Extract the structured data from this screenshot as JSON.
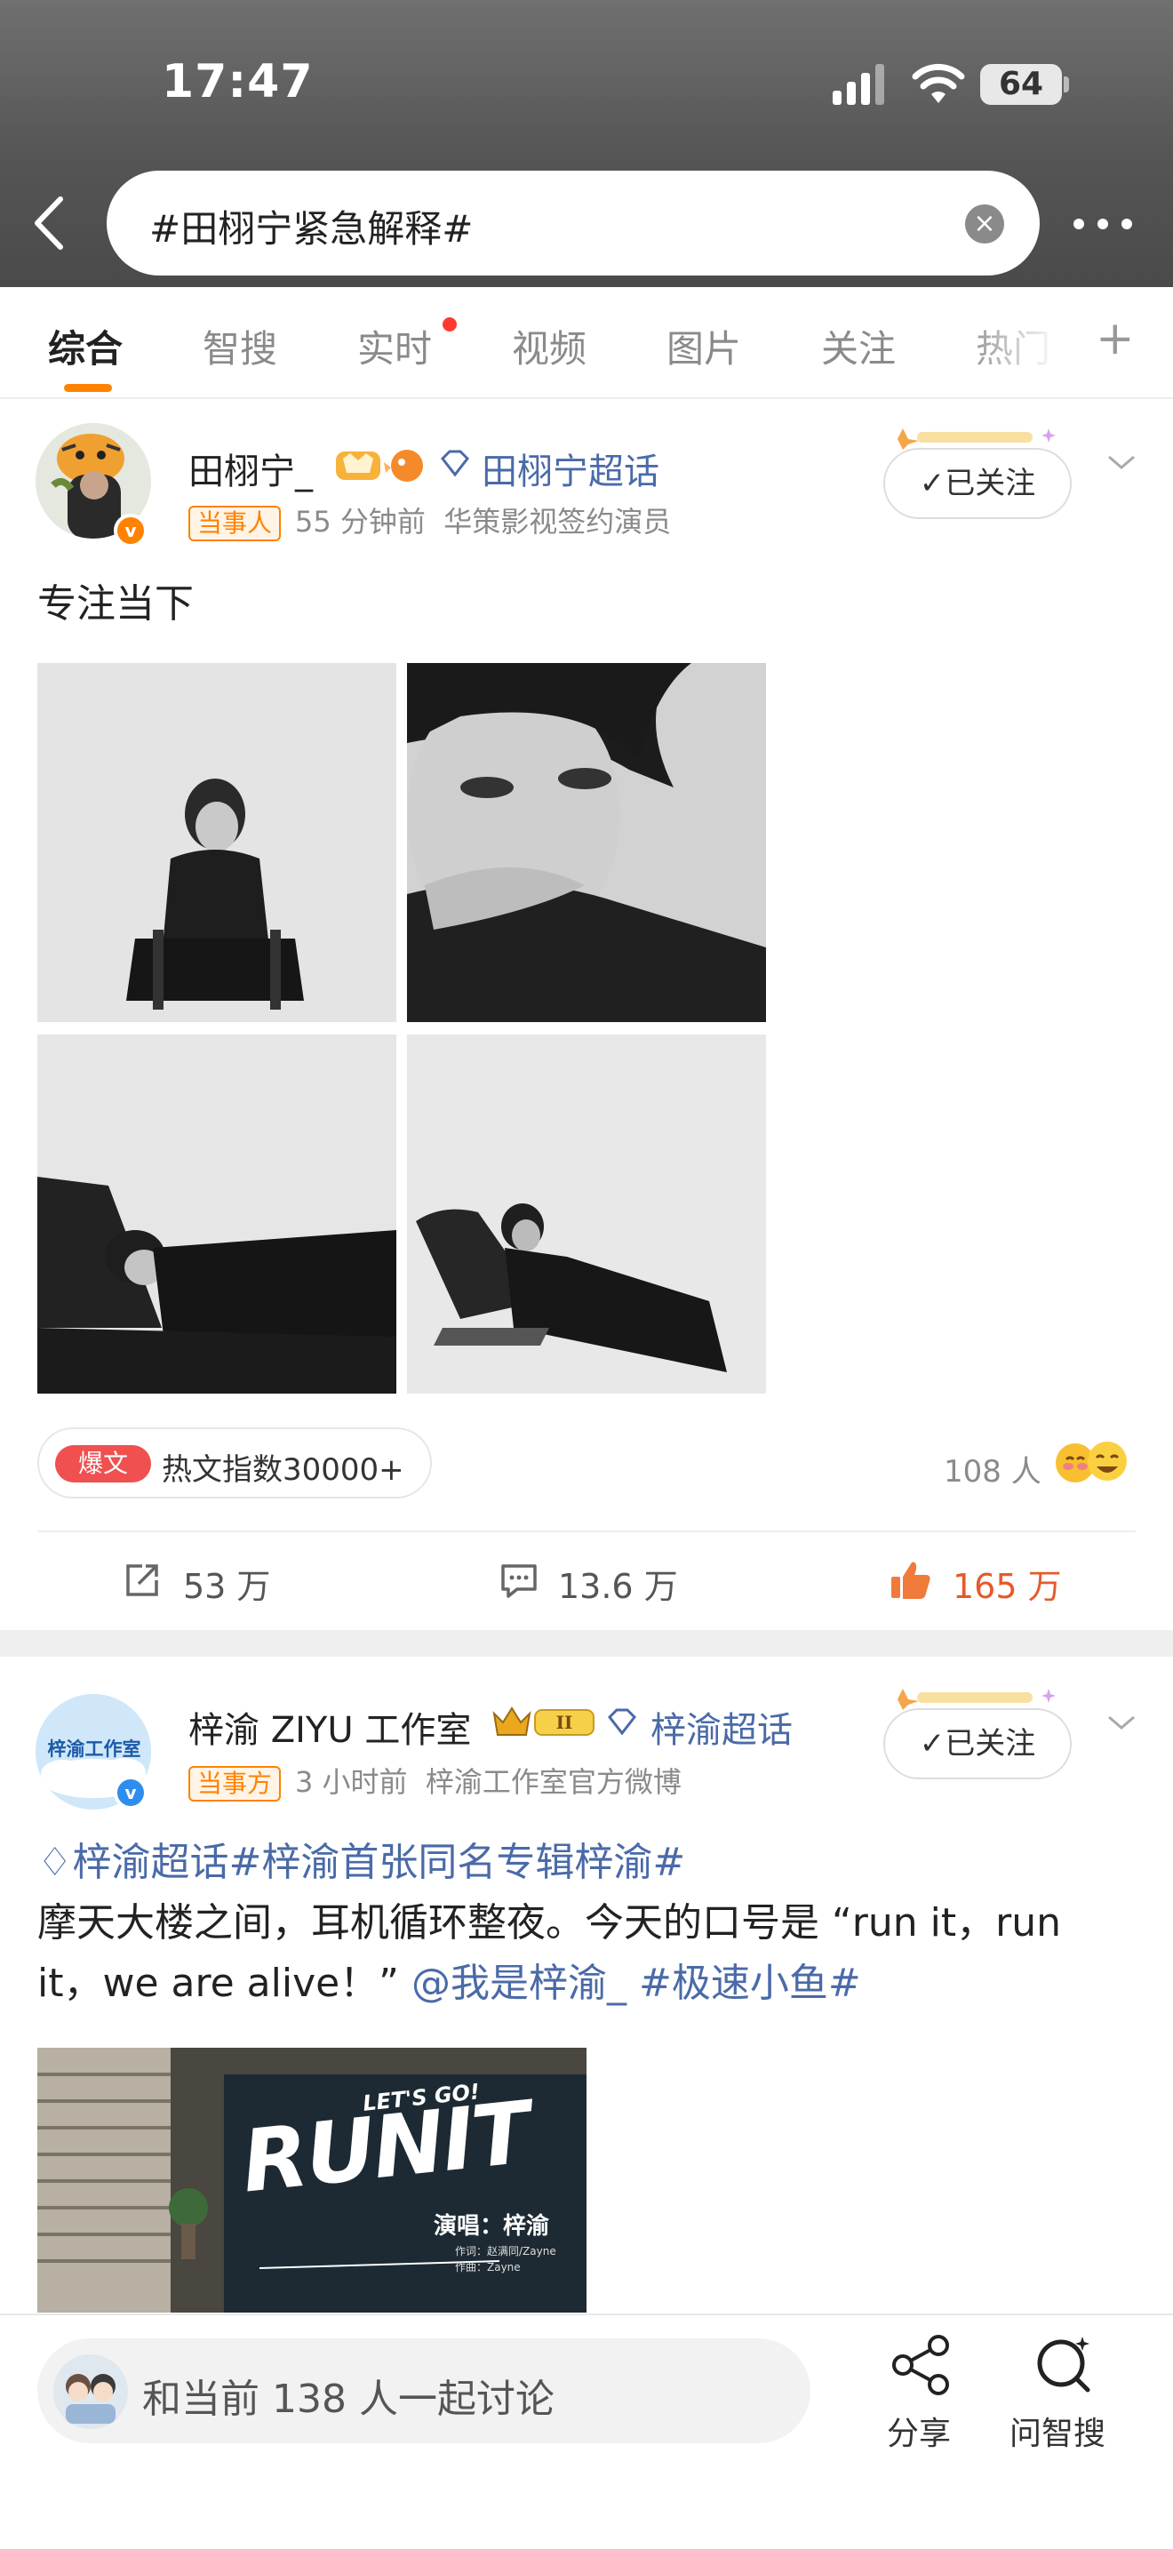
{
  "status_bar": {
    "time": "17:47",
    "battery": "64"
  },
  "search": {
    "query": "#田栩宁紧急解释#"
  },
  "tabs": [
    {
      "label": "综合",
      "active": true
    },
    {
      "label": "智搜"
    },
    {
      "label": "实时",
      "has_dot": true
    },
    {
      "label": "视频"
    },
    {
      "label": "图片"
    },
    {
      "label": "关注"
    },
    {
      "label": "热门"
    }
  ],
  "post1": {
    "username": "田栩宁_",
    "topic": "田栩宁超话",
    "tag": "当事人",
    "time": "55 分钟前",
    "source": "华策影视签约演员",
    "follow_label": "已关注",
    "text": "专注当下",
    "hot_badge": "爆文",
    "hot_text": "热文指数30000+",
    "people": "108 人",
    "reposts": "53 万",
    "comments": "13.6 万",
    "likes": "165 万"
  },
  "post2": {
    "username": "梓渝 ZIYU 工作室",
    "topic": "梓渝超话",
    "tag": "当事方",
    "time": "3 小时前",
    "source": "梓渝工作室官方微博",
    "follow_label": "已关注",
    "avatar_text": "梓渝工作室",
    "line1_topic": "梓渝超话",
    "line1_hashtag": "#梓渝首张同名专辑梓渝#",
    "line2": "摩天大楼之间，耳机循环整夜。今天的口号是 “run it，run",
    "line3_text": "it，we are alive！” ",
    "line3_mention": "@我是梓渝_",
    "line3_hashtag": " #极速小鱼#",
    "poster": {
      "letsgo": "LET'S GO!",
      "title": "RUNIT",
      "singer": "演唱：梓渝",
      "lyricist": "作词：赵满同/Zayne",
      "composer": "作曲：Zayne"
    }
  },
  "bottom_bar": {
    "discuss": "和当前 138 人一起讨论",
    "share": "分享",
    "ask": "问智搜"
  },
  "colors": {
    "accent": "#ff8200",
    "link": "#4a6aa8",
    "like": "#e55a2b"
  }
}
